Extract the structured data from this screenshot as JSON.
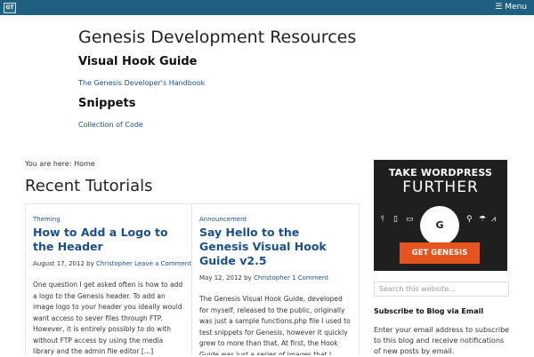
{
  "topbar": {
    "logo_text": "GT",
    "menu_label": "Menu",
    "menu_icon": "hamburger-icon",
    "bar_color": "#1f5f7f"
  },
  "header": {
    "site_title": "Genesis Development Resources",
    "resources": [
      {
        "heading": "Visual Hook Guide",
        "link": "The Genesis Developer's Handbook"
      },
      {
        "heading": "Snippets",
        "link": "Collection of Code"
      }
    ]
  },
  "breadcrumb": {
    "label": "You are here:",
    "current": "Home"
  },
  "main": {
    "section_title": "Recent Tutorials",
    "posts": [
      {
        "category": "Theming",
        "title": "How to Add a Logo to the Header",
        "date": "August 17, 2012",
        "by": "by",
        "author": "Christopher",
        "comments": "Leave a Comment",
        "excerpt": "One question I get asked often is how to add a logo to the Genesis header. To add an image logo to your header you ideally would want access to sever files through FTP. However, it is entirely possibly to do with without FTP access by using the media library and the admin file editor […]"
      },
      {
        "category": "Announcement",
        "title": "Say Hello to the Genesis Visual Hook Guide v2.5",
        "date": "May 12, 2012",
        "by": "by",
        "author": "Christopher",
        "comments": "1 Comment",
        "excerpt": "The Genesis Visual Hook Guide, developed for myself, released to the public, originally was just a sample functions.php file I used to test snippets for Genesis, however it quickly grew to more than that. At first, the Hook Guide was just a series of images that I snapped of an early version of what it […]"
      }
    ]
  },
  "sidebar": {
    "promo": {
      "line1": "TAKE WORDPRESS",
      "line2": "FURTHER",
      "circle_letter": "G",
      "cta": "GET GENESIS",
      "cta_color": "#e5541e",
      "bg_color": "#1f1f1f",
      "icons": [
        "thermometer-icon",
        "mobile-icon",
        "tablet-icon",
        "gauge-icon",
        "pin-icon",
        "parachute-icon",
        "lightbulb-icon",
        "chart-icon"
      ]
    },
    "search_placeholder": "Search this website…",
    "subscribe_heading": "Subscribe to Blog via Email",
    "subscribe_text": "Enter your email address to subscribe to this blog and receive notifications of new posts by email."
  }
}
